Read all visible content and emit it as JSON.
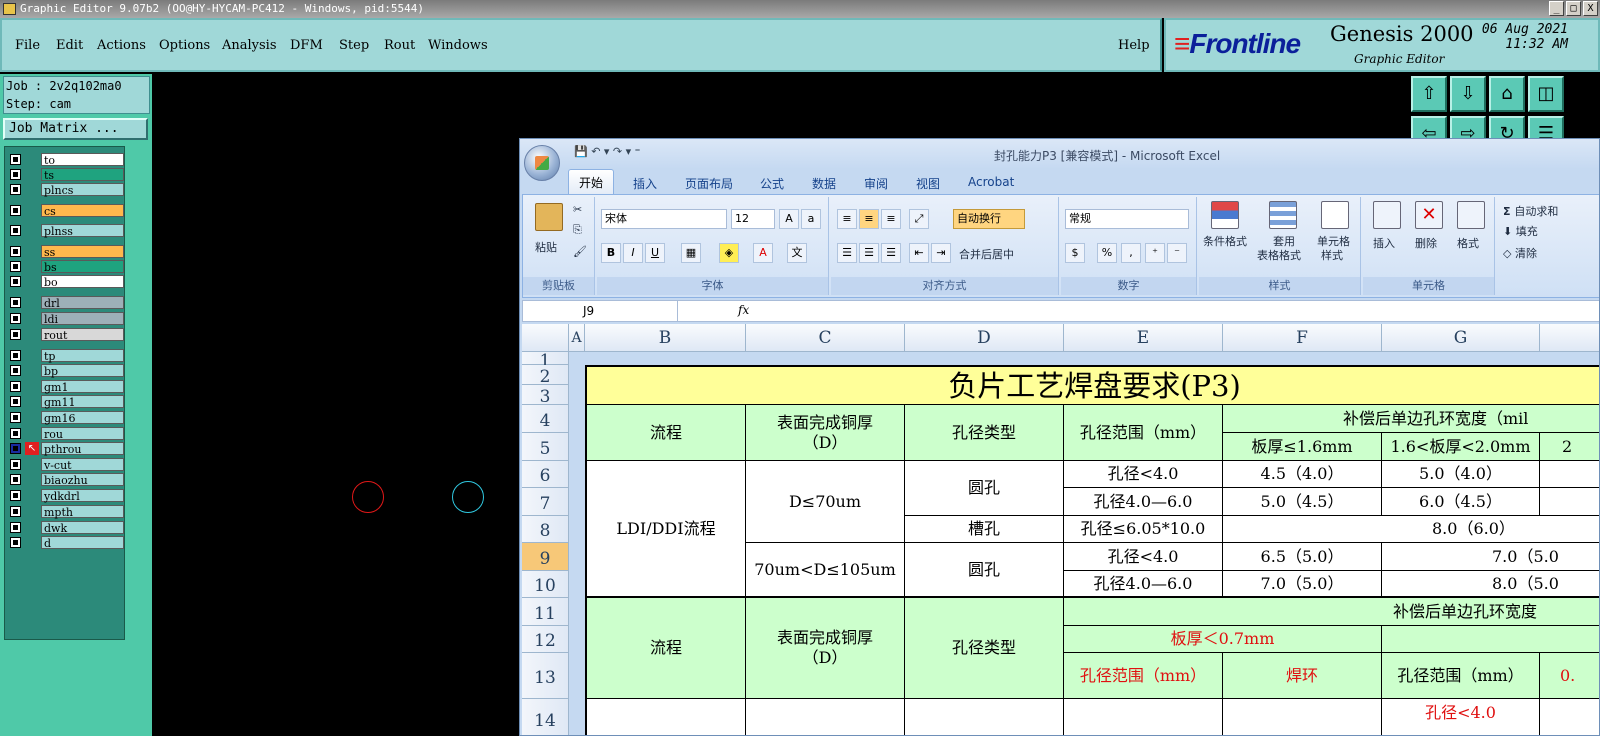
{
  "window": {
    "title": "Graphic Editor 9.07b2 (OO@HY-HYCAM-PC412 - Windows, pid:5544)",
    "buttons": [
      "_",
      "□",
      "X"
    ]
  },
  "menu": {
    "items": [
      "File",
      "Edit",
      "Actions",
      "Options",
      "Analysis",
      "DFM",
      "Step",
      "Rout",
      "Windows"
    ],
    "help": "Help"
  },
  "brand": {
    "logo": "Frontline",
    "product": "Genesis 2000",
    "subtitle": "Graphic Editor",
    "date": "06 Aug 2021",
    "time": "11:32 AM"
  },
  "job": {
    "job_line": "Job : 2v2q102ma0",
    "step_line": "Step: cam",
    "matrix_button": "Job Matrix ..."
  },
  "layers": [
    {
      "name": "to",
      "color": "#ffffff",
      "pen": "✎"
    },
    {
      "name": "ts",
      "color": "#1fa37f",
      "pen": "✎"
    },
    {
      "name": "plncs",
      "color": "#a0d8d8",
      "pen": ""
    },
    {
      "name": "cs",
      "color": "#ffb84d",
      "pen": "✎"
    },
    {
      "name": "plnss",
      "color": "#a0d8d8",
      "pen": ""
    },
    {
      "name": "ss",
      "color": "#ffb84d",
      "pen": "✎"
    },
    {
      "name": "bs",
      "color": "#1fa37f",
      "pen": "✎"
    },
    {
      "name": "bo",
      "color": "#ffffff",
      "pen": "✎"
    },
    {
      "name": "drl",
      "color": "#9db0b8",
      "pen": ""
    },
    {
      "name": "ldi",
      "color": "#9db0b8",
      "pen": ""
    },
    {
      "name": "rout",
      "color": "#d8d8d8",
      "pen": ""
    },
    {
      "name": "tp",
      "color": "#a0d8d8",
      "pen": ""
    },
    {
      "name": "bp",
      "color": "#a0d8d8",
      "pen": "✎"
    },
    {
      "name": "gm1",
      "color": "#a0d8d8",
      "pen": "✎"
    },
    {
      "name": "gm11",
      "color": "#a0d8d8",
      "pen": "✎"
    },
    {
      "name": "gm16",
      "color": "#a0d8d8",
      "pen": "✎"
    },
    {
      "name": "rou",
      "color": "#a0d8d8",
      "pen": "✎"
    },
    {
      "name": "pthrou",
      "color": "#a0d8d8",
      "pen": "▣"
    },
    {
      "name": "v-cut",
      "color": "#a0d8d8",
      "pen": ""
    },
    {
      "name": "biaozhu",
      "color": "#a0d8d8",
      "pen": ""
    },
    {
      "name": "ydkdrl",
      "color": "#a0d8d8",
      "pen": ""
    },
    {
      "name": "mpth",
      "color": "#a0d8d8",
      "pen": ""
    },
    {
      "name": "dwk",
      "color": "#a0d8d8",
      "pen": ""
    },
    {
      "name": "d",
      "color": "#a0d8d8",
      "pen": ""
    }
  ],
  "excel": {
    "title": "封孔能力P3  [兼容模式] - Microsoft Excel",
    "tabs": [
      "开始",
      "插入",
      "页面布局",
      "公式",
      "数据",
      "审阅",
      "视图",
      "Acrobat"
    ],
    "ribbon": {
      "clipboard": {
        "paste": "粘贴",
        "label": "剪贴板"
      },
      "font": {
        "name": "宋体",
        "size": "12",
        "label": "字体"
      },
      "alignment": {
        "wrap": "自动换行",
        "merge": "合并后居中",
        "label": "对齐方式"
      },
      "number": {
        "format": "常规",
        "percent": "%",
        "comma": ",",
        "label": "数字"
      },
      "styles": {
        "conditional": "条件格式",
        "table_a": "套用",
        "table_b": "表格格式",
        "cell_a": "单元格",
        "cell_b": "样式",
        "label": "样式"
      },
      "cells": {
        "insert": "插入",
        "delete": "删除",
        "format": "格式",
        "label": "单元格"
      },
      "editing": {
        "autosum": "自动求和",
        "fill": "填充",
        "clear": "清除"
      }
    },
    "name_box": "J9",
    "fx": "fx",
    "columns": [
      "A",
      "B",
      "C",
      "D",
      "E",
      "F",
      "G"
    ],
    "rows": [
      "1",
      "2",
      "3",
      "4",
      "5",
      "6",
      "7",
      "8",
      "9",
      "10",
      "11",
      "12",
      "13",
      "14"
    ],
    "sheet": {
      "title": "负片工艺焊盘要求(P3)",
      "h_process": "流程",
      "h_copper": "表面完成铜厚\n（D）",
      "h_hole_type": "孔径类型",
      "h_hole_range": "孔径范围（mm）",
      "h_ring": "补偿后单边孔环宽度（mil",
      "h_thick1": "板厚≤1.6mm",
      "h_thick2": "1.6<板厚<2.0mm",
      "h_thick3": "2",
      "process_ldi": "LDI/DDI流程",
      "copper1": "D≤70um",
      "copper2": "70um<D≤105um",
      "round": "圆孔",
      "slot": "槽孔",
      "r6": [
        "孔径<4.0",
        "4.5（4.0）",
        "5.0（4.0）"
      ],
      "r7": [
        "孔径4.0—6.0",
        "5.0（4.5）",
        "6.0（4.5）"
      ],
      "r8": [
        "孔径≤6.05*10.0",
        "8.0（6.0）"
      ],
      "r9": [
        "孔径<4.0",
        "6.5（5.0）",
        "7.0（5.0"
      ],
      "r10": [
        "孔径4.0—6.0",
        "7.0（5.0）",
        "8.0（5.0"
      ],
      "h2_ring": "补偿后单边孔环宽度",
      "h2_thin": "板厚＜0.7mm",
      "h2_range": "孔径范围（mm）",
      "h2_ring_col": "焊环",
      "h2_range_g": "孔径范围（mm）",
      "h2_h": "0.",
      "r14_g": "孔径<4.0"
    }
  }
}
